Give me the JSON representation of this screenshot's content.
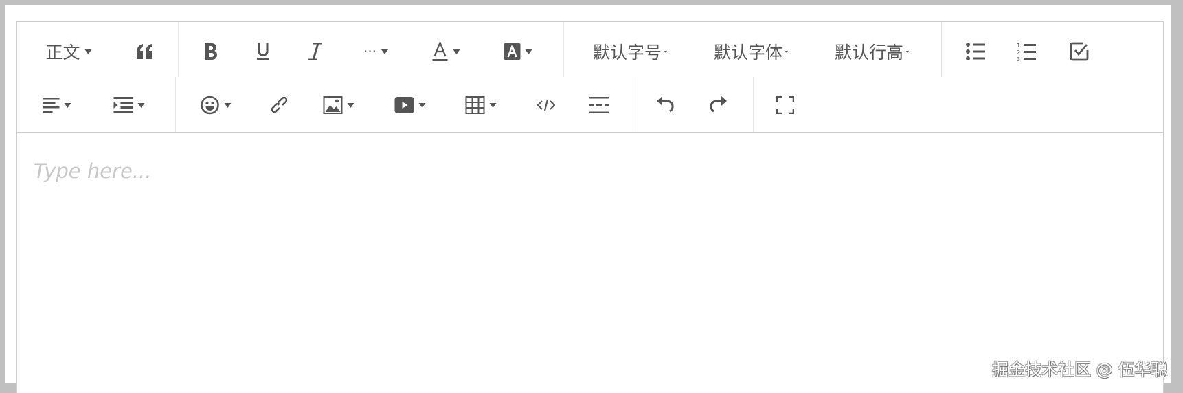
{
  "toolbar": {
    "heading": "正文",
    "font_size": "默认字号",
    "font_family": "默认字体",
    "line_height": "默认行高",
    "icons": [
      "quote-icon",
      "bold-icon",
      "underline-icon",
      "italic-icon",
      "more-icon",
      "font-color-icon",
      "background-color-icon",
      "bulleted-list-icon",
      "numbered-list-icon",
      "todo-icon",
      "align-icon",
      "indent-icon",
      "emoji-icon",
      "link-icon",
      "image-icon",
      "video-icon",
      "table-icon",
      "code-icon",
      "divider-icon",
      "undo-icon",
      "redo-icon",
      "fullscreen-icon"
    ]
  },
  "editor": {
    "placeholder": "Type here..."
  },
  "watermark": "掘金技术社区 @ 伍华聪",
  "colors": {
    "icon": "#555555",
    "border": "#cccccc",
    "frame": "#c0c0c0"
  }
}
